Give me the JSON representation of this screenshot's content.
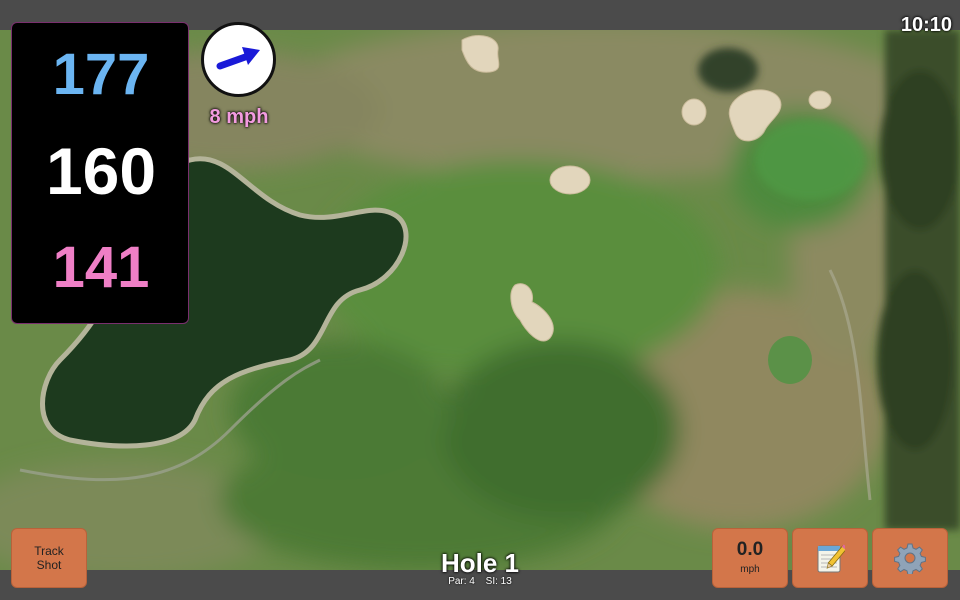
{
  "status": {
    "time": "10:10"
  },
  "distances": {
    "back": "177",
    "middle": "160",
    "front": "141"
  },
  "wind": {
    "speed": "8 mph",
    "direction_icon": "wind-arrow-icon"
  },
  "buttons": {
    "track_line1": "Track",
    "track_line2": "Shot",
    "speed_value": "0.0",
    "speed_unit": "mph",
    "notes_icon": "notepad-icon",
    "settings_icon": "gear-icon"
  },
  "hole": {
    "title": "Hole 1",
    "par": "Par: 4",
    "si": "SI: 13"
  },
  "colors": {
    "back_distance": "#6bb5f2",
    "middle_distance": "#ffffff",
    "front_distance": "#ef7fc6",
    "button": "#d3764a",
    "wind_text": "#f39be0"
  }
}
